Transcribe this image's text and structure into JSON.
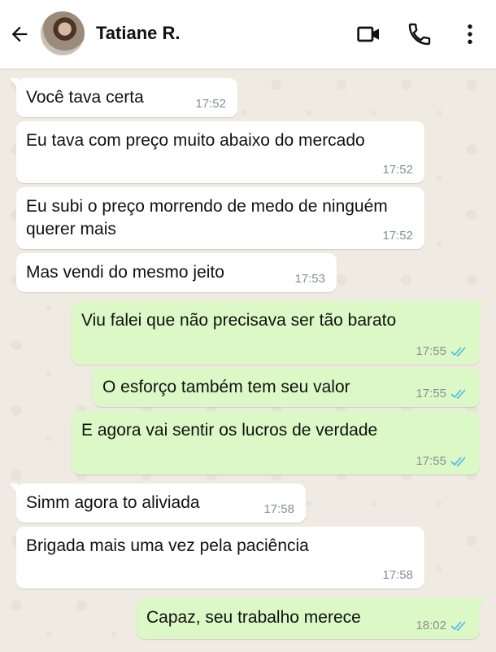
{
  "header": {
    "contact_name": "Tatiane R.",
    "icons": [
      "back-arrow-icon",
      "video-call-icon",
      "phone-call-icon",
      "more-vertical-icon"
    ]
  },
  "messages": [
    {
      "text": "Você tava certa",
      "time": "17:52",
      "dir": "in"
    },
    {
      "text": "Eu tava com preço muito abaixo do mercado",
      "time": "17:52",
      "dir": "in"
    },
    {
      "text": "Eu subi o preço morrendo de medo de ninguém querer mais",
      "time": "17:52",
      "dir": "in"
    },
    {
      "text": "Mas vendi do mesmo jeito",
      "time": "17:53",
      "dir": "in"
    },
    {
      "text": "Viu falei que não precisava ser tão barato",
      "time": "17:55",
      "dir": "out"
    },
    {
      "text": "O esforço também tem seu valor",
      "time": "17:55",
      "dir": "out"
    },
    {
      "text": "E agora vai sentir os lucros de verdade",
      "time": "17:55",
      "dir": "out"
    },
    {
      "text": "Simm agora to aliviada",
      "time": "17:58",
      "dir": "in"
    },
    {
      "text": "Brigada mais uma vez pela paciência",
      "time": "17:58",
      "dir": "in"
    },
    {
      "text": "Capaz, seu trabalho merece",
      "time": "18:02",
      "dir": "out"
    }
  ],
  "colors": {
    "incoming_bubble": "#ffffff",
    "outgoing_bubble": "#dcf8c6",
    "read_ticks": "#4fb6ec",
    "chat_background": "#efeae2"
  }
}
